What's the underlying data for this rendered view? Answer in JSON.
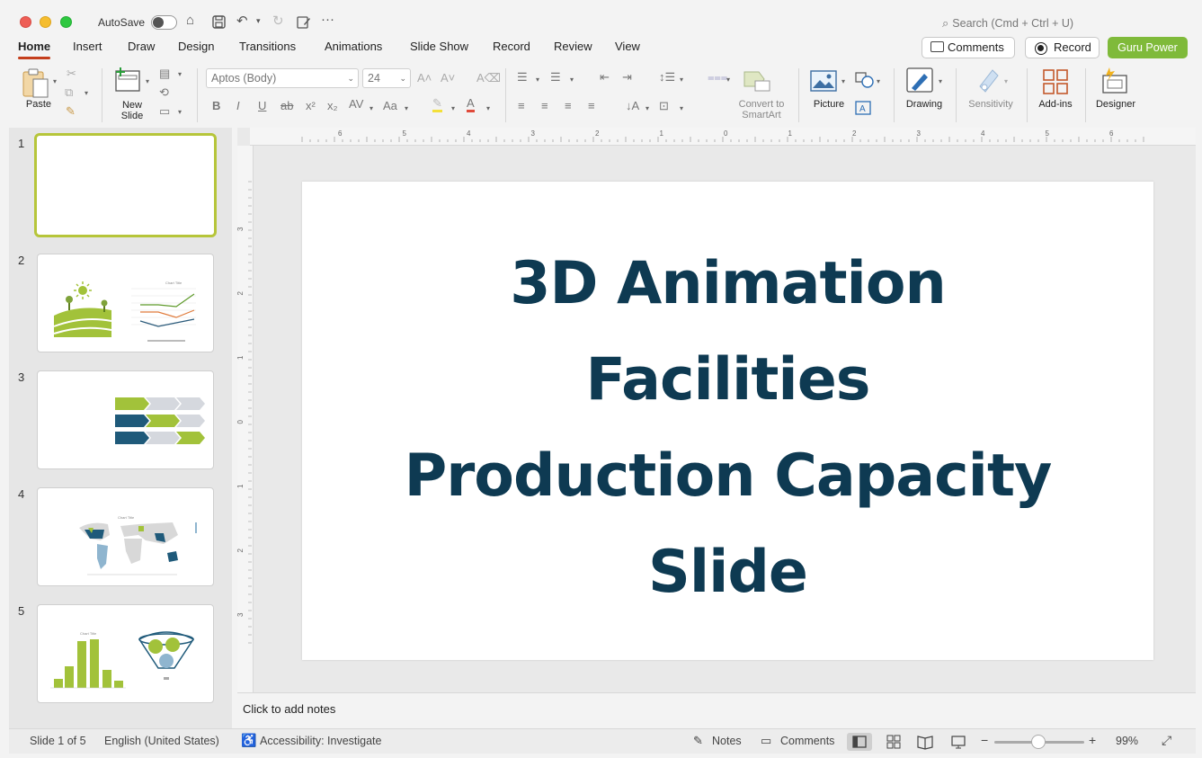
{
  "titlebar": {
    "autosave_label": "AutoSave",
    "search_placeholder": "Search (Cmd + Ctrl + U)"
  },
  "tabs": [
    "Home",
    "Insert",
    "Draw",
    "Design",
    "Transitions",
    "Animations",
    "Slide Show",
    "Record",
    "Review",
    "View"
  ],
  "actions": {
    "comments": "Comments",
    "record": "Record",
    "guru": "Guru Power"
  },
  "ribbon": {
    "paste": "Paste",
    "new_slide_1": "New",
    "new_slide_2": "Slide",
    "font_name": "Aptos (Body)",
    "font_size": "24",
    "convert_1": "Convert to",
    "convert_2": "SmartArt",
    "picture": "Picture",
    "drawing": "Drawing",
    "sensitivity": "Sensitivity",
    "addins": "Add-ins",
    "designer": "Designer"
  },
  "ruler": {
    "h": [
      "6",
      "5",
      "4",
      "3",
      "2",
      "1",
      "0",
      "1",
      "2",
      "3",
      "4",
      "5",
      "6"
    ],
    "v": [
      "3",
      "2",
      "1",
      "0",
      "1",
      "2",
      "3"
    ]
  },
  "slides": [
    {
      "num": "1"
    },
    {
      "num": "2",
      "chart_title": "Chart Title"
    },
    {
      "num": "3"
    },
    {
      "num": "4",
      "chart_title": "Chart Title"
    },
    {
      "num": "5",
      "chart_title": "Chart Title"
    }
  ],
  "slide": {
    "title_lines": [
      "3D Animation",
      "Facilities",
      "Production Capacity",
      "Slide"
    ]
  },
  "notes": {
    "placeholder": "Click to add notes"
  },
  "status": {
    "slide_count": "Slide 1 of 5",
    "language": "English (United States)",
    "accessibility": "Accessibility: Investigate",
    "notes": "Notes",
    "comments": "Comments",
    "zoom_minus": "−",
    "zoom_plus": "+",
    "zoom": "99%"
  },
  "colors": {
    "accent": "#c43e1c",
    "title": "#0e3a52",
    "green": "#a2c23a",
    "guru": "#7fba3a"
  }
}
